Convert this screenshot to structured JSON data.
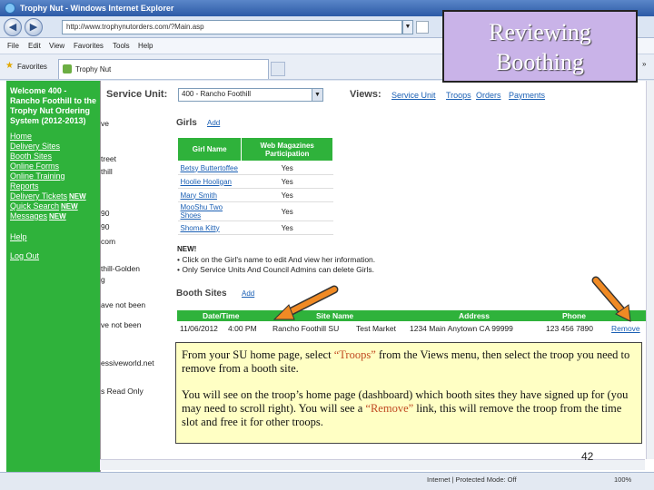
{
  "browser": {
    "title": "Trophy Nut - Windows Internet Explorer",
    "url": "http://www.trophynutorders.com/?Main.asp",
    "menus": [
      "File",
      "Edit",
      "View",
      "Favorites",
      "Tools",
      "Help"
    ],
    "favorites_label": "Favorites",
    "tab_label": "Trophy Nut"
  },
  "sidebar": {
    "welcome": "Welcome 400 - Rancho Foothill to the Trophy Nut Ordering System (2012-2013)",
    "links": [
      {
        "label": "Home"
      },
      {
        "label": "Delivery Sites"
      },
      {
        "label": "Booth Sites"
      },
      {
        "label": "Online Forms"
      },
      {
        "label": "Online Training"
      },
      {
        "label": "Reports"
      },
      {
        "label": "Delivery Tickets",
        "badge": "NEW"
      },
      {
        "label": "Quick Search",
        "badge": "NEW"
      },
      {
        "label": "Messages",
        "badge": "NEW"
      },
      {
        "label": "Help"
      },
      {
        "label": "Log Out"
      }
    ]
  },
  "left_column": [
    "ve",
    "treet",
    "thill",
    "90",
    "90",
    "com",
    "thill-Golden",
    "g",
    "ave not been",
    "ve not been",
    "essiveworld.net",
    "s Read Only"
  ],
  "service_unit": {
    "label": "Service Unit:",
    "selected": "400 - Rancho Foothill"
  },
  "views": {
    "label": "Views:",
    "links": [
      "Service Unit",
      "Troops",
      "Orders",
      "Payments"
    ]
  },
  "girls": {
    "title": "Girls",
    "add": "Add",
    "headers": [
      "Girl Name",
      "Web Magazines Participation"
    ],
    "rows": [
      {
        "name": "Betsy Buttertoffee",
        "web": "Yes"
      },
      {
        "name": "Hoolie Hooligan",
        "web": "Yes"
      },
      {
        "name": "Mary Smith",
        "web": "Yes"
      },
      {
        "name": "MooShu Two Shoes",
        "web": "Yes"
      },
      {
        "name": "Shoma Kitty",
        "web": "Yes"
      }
    ]
  },
  "new_notice": {
    "title": "NEW!",
    "lines": [
      "• Click on the Girl's name to edit And view her information.",
      "• Only Service Units And Council Admins can delete Girls."
    ]
  },
  "booth_sites": {
    "title": "Booth Sites",
    "add": "Add",
    "headers": [
      "Date/Time",
      "Site Name",
      "Address",
      "Phone"
    ],
    "row": {
      "date": "11/06/2012",
      "time": "4:00 PM",
      "troop": "Rancho Foothill SU",
      "site": "Test Market",
      "address": "1234 Main Anytown CA 99999",
      "phone": "123 456 7890",
      "action": "Remove"
    }
  },
  "slide": {
    "title_line1": "Reviewing",
    "title_line2": "Boothing",
    "para1_a": "From your SU home page, select ",
    "para1_hl": "“Troops”",
    "para1_b": " from the Views menu, then select the troop you need to remove from a booth site.",
    "para2_a": "You will see on the troop’s home page (dashboard) which booth sites they have signed up for (you may need to scroll right). You will see a ",
    "para2_hl": "“Remove”",
    "para2_b": " link, this will remove the troop from the time slot and free it for other troops.",
    "page_number": "42",
    "arrow_color": "#f08a24"
  },
  "status": {
    "zone": "Internet | Protected Mode: Off",
    "zoom": "100%"
  }
}
